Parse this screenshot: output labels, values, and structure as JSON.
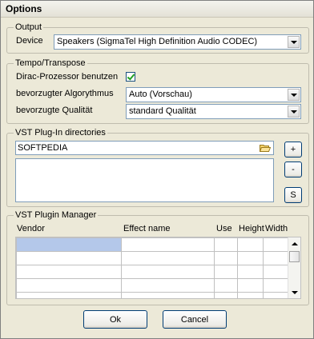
{
  "window": {
    "title": "Options"
  },
  "output": {
    "legend": "Output",
    "device_label": "Device",
    "device_value": "Speakers (SigmaTel High Definition Audio CODEC)"
  },
  "tempo": {
    "legend": "Tempo/Transpose",
    "dirac_label": "Dirac-Prozessor benutzen",
    "dirac_checked": true,
    "algorithm_label": "bevorzugter Algorythmus",
    "algorithm_value": "Auto (Vorschau)",
    "quality_label": "bevorzugte Qualität",
    "quality_value": "standard Qualität"
  },
  "vst_dirs": {
    "legend": "VST Plug-In directories",
    "path_value": "SOFTPEDIA",
    "add_label": "+",
    "remove_label": "-",
    "s_label": "S"
  },
  "vst_manager": {
    "legend": "VST Plugin Manager",
    "columns": [
      "Vendor",
      "Effect name",
      "Use",
      "Height",
      "Width"
    ],
    "selected_row": 0
  },
  "footer": {
    "ok_label": "Ok",
    "cancel_label": "Cancel"
  },
  "colors": {
    "selection": "#b4c8ea",
    "check": "#21a121"
  }
}
